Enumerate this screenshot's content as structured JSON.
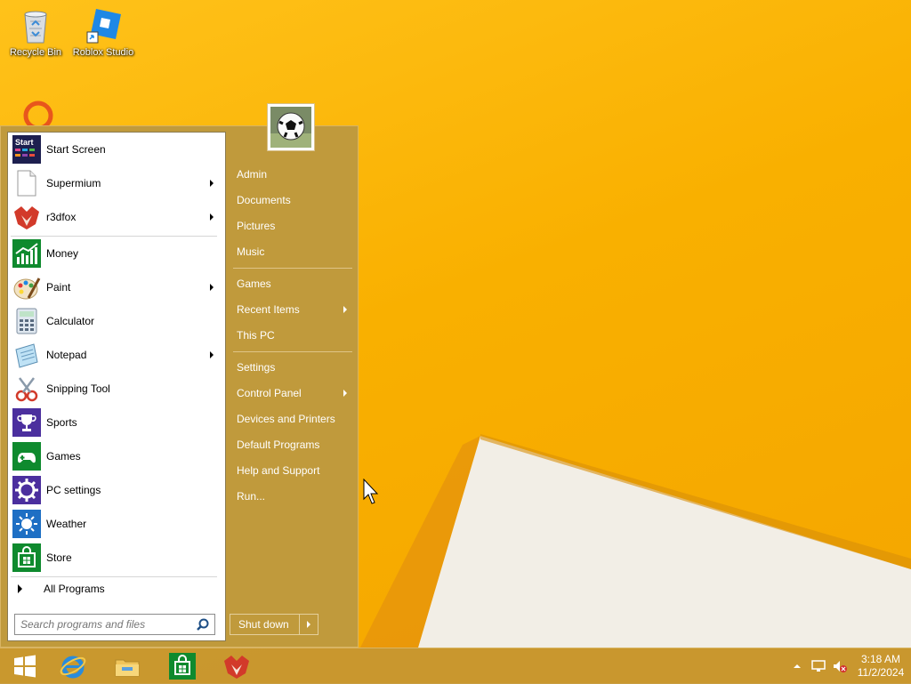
{
  "desktop": {
    "icons": [
      {
        "label": "Recycle Bin",
        "icon": "recycle-bin-icon"
      },
      {
        "label": "Roblox Studio",
        "icon": "roblox-studio-icon"
      }
    ]
  },
  "start_menu": {
    "pinned": [
      {
        "label": "Start Screen",
        "icon": "start-screen-icon",
        "has_submenu": false
      },
      {
        "label": "Supermium",
        "icon": "document-icon",
        "has_submenu": true
      },
      {
        "label": "r3dfox",
        "icon": "r3dfox-icon",
        "has_submenu": true
      }
    ],
    "recent": [
      {
        "label": "Money",
        "icon": "money-icon",
        "has_submenu": false
      },
      {
        "label": "Paint",
        "icon": "paint-icon",
        "has_submenu": true
      },
      {
        "label": "Calculator",
        "icon": "calculator-icon",
        "has_submenu": false
      },
      {
        "label": "Notepad",
        "icon": "notepad-icon",
        "has_submenu": true
      },
      {
        "label": "Snipping Tool",
        "icon": "snipping-tool-icon",
        "has_submenu": false
      },
      {
        "label": "Sports",
        "icon": "trophy-icon",
        "has_submenu": false
      },
      {
        "label": "Games",
        "icon": "gamepad-icon",
        "has_submenu": false
      },
      {
        "label": "PC settings",
        "icon": "gear-icon",
        "has_submenu": false
      },
      {
        "label": "Weather",
        "icon": "sun-icon",
        "has_submenu": false
      },
      {
        "label": "Store",
        "icon": "store-icon",
        "has_submenu": false
      }
    ],
    "all_programs": "All Programs",
    "search_placeholder": "Search programs and files",
    "right_links": [
      {
        "label": "Admin",
        "has_submenu": false
      },
      {
        "label": "Documents",
        "has_submenu": false
      },
      {
        "label": "Pictures",
        "has_submenu": false
      },
      {
        "label": "Music",
        "has_submenu": false
      },
      {
        "label": "Games",
        "has_submenu": false
      },
      {
        "label": "Recent Items",
        "has_submenu": true
      },
      {
        "label": "This PC",
        "has_submenu": false
      },
      {
        "label": "Settings",
        "has_submenu": false
      },
      {
        "label": "Control Panel",
        "has_submenu": true
      },
      {
        "label": "Devices and Printers",
        "has_submenu": false
      },
      {
        "label": "Default Programs",
        "has_submenu": false
      },
      {
        "label": "Help and Support",
        "has_submenu": false
      },
      {
        "label": "Run...",
        "has_submenu": false
      }
    ],
    "shutdown_label": "Shut down",
    "user_avatar": "soccer-ball-avatar"
  },
  "taskbar": {
    "apps": [
      "internet-explorer-icon",
      "file-explorer-icon",
      "store-icon",
      "r3dfox-icon"
    ],
    "clock_time": "3:18 AM",
    "clock_date": "11/2/2024"
  },
  "colors": {
    "wallpaper": "#f9b000",
    "menu_accent": "#c09a3c",
    "tile_green": "#0f8a2e",
    "tile_purple": "#4b2f9e",
    "tile_blue": "#1e6fc4"
  }
}
